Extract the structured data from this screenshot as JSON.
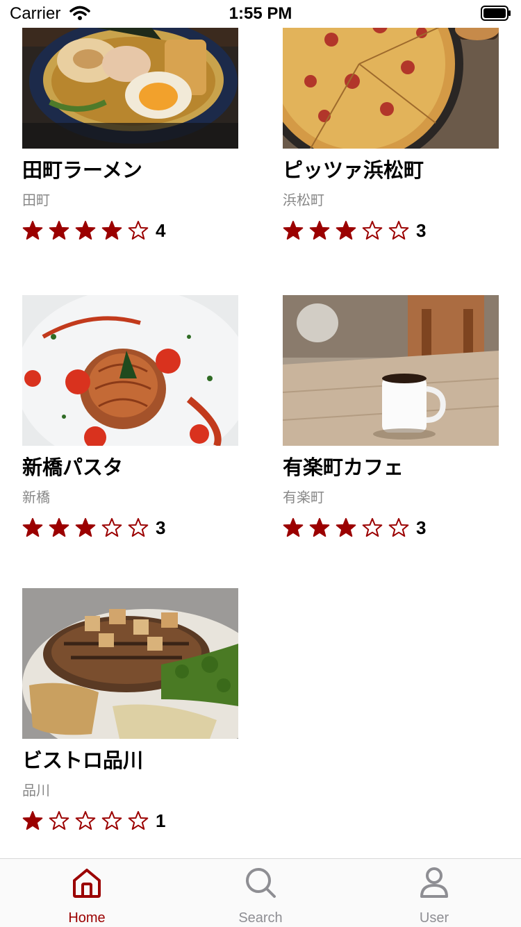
{
  "status_bar": {
    "carrier": "Carrier",
    "time": "1:55 PM"
  },
  "colors": {
    "accent": "#9b0000",
    "inactive": "#8e8e93",
    "secondary_text": "#888888"
  },
  "restaurants": [
    {
      "name": "田町ラーメン",
      "area": "田町",
      "rating": 4,
      "rating_label": "4",
      "image": "ramen-photo"
    },
    {
      "name": "ピッツァ浜松町",
      "area": "浜松町",
      "rating": 3,
      "rating_label": "3",
      "image": "pizza-photo"
    },
    {
      "name": "新橋パスタ",
      "area": "新橋",
      "rating": 3,
      "rating_label": "3",
      "image": "pasta-photo"
    },
    {
      "name": "有楽町カフェ",
      "area": "有楽町",
      "rating": 3,
      "rating_label": "3",
      "image": "coffee-photo"
    },
    {
      "name": "ビストロ品川",
      "area": "品川",
      "rating": 1,
      "rating_label": "1",
      "image": "steak-photo"
    }
  ],
  "tabs": [
    {
      "label": "Home",
      "icon": "home-icon",
      "active": true
    },
    {
      "label": "Search",
      "icon": "search-icon",
      "active": false
    },
    {
      "label": "User",
      "icon": "user-icon",
      "active": false
    }
  ]
}
